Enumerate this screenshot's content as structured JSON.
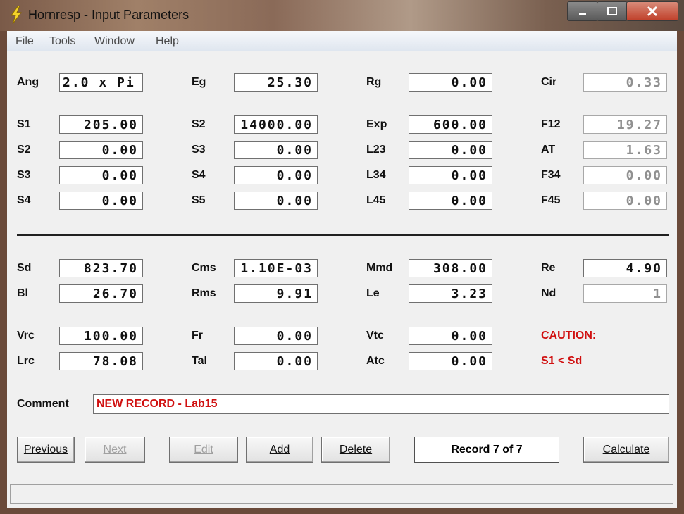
{
  "window": {
    "title": "Hornresp - Input Parameters",
    "icon": "lightning-bolt-icon"
  },
  "menu": [
    "File",
    "Tools",
    "Window",
    "Help"
  ],
  "row_ang": {
    "Ang": "2.0 x Pi",
    "Eg": "25.30",
    "Rg": "0.00",
    "Cir": "0.33"
  },
  "labels": {
    "ang": "Ang",
    "eg": "Eg",
    "rg": "Rg",
    "cir": "Cir",
    "s1": "S1",
    "s2b": "S2",
    "exp": "Exp",
    "f12": "F12",
    "s2": "S2",
    "s3b": "S3",
    "l23": "L23",
    "at": "AT",
    "s3": "S3",
    "s4b": "S4",
    "l34": "L34",
    "f34": "F34",
    "s4": "S4",
    "s5": "S5",
    "l45": "L45",
    "f45": "F45",
    "sd": "Sd",
    "cms": "Cms",
    "mmd": "Mmd",
    "re": "Re",
    "bl": "Bl",
    "rms": "Rms",
    "le": "Le",
    "nd": "Nd",
    "vrc": "Vrc",
    "fr": "Fr",
    "vtc": "Vtc",
    "lrc": "Lrc",
    "tal": "Tal",
    "atc": "Atc",
    "comment": "Comment"
  },
  "values": {
    "ang": "2.0 x Pi",
    "eg": "25.30",
    "rg": "0.00",
    "cir": "0.33",
    "s1": "205.00",
    "s2b": "14000.00",
    "exp": "600.00",
    "f12": "19.27",
    "s2": "0.00",
    "s3b": "0.00",
    "l23": "0.00",
    "at": "1.63",
    "s3": "0.00",
    "s4b": "0.00",
    "l34": "0.00",
    "f34": "0.00",
    "s4": "0.00",
    "s5": "0.00",
    "l45": "0.00",
    "f45": "0.00",
    "sd": "823.70",
    "cms": "1.10E-03",
    "mmd": "308.00",
    "re": "4.90",
    "bl": "26.70",
    "rms": "9.91",
    "le": "3.23",
    "nd": "1",
    "vrc": "100.00",
    "fr": "0.00",
    "vtc": "0.00",
    "lrc": "78.08",
    "tal": "0.00",
    "atc": "0.00"
  },
  "caution": {
    "title": "CAUTION:",
    "message": "S1 < Sd",
    "color": "#d01010"
  },
  "comment": "NEW RECORD - Lab15",
  "buttons": {
    "previous": "Previous",
    "next": "Next",
    "edit": "Edit",
    "add": "Add",
    "delete": "Delete",
    "calculate": "Calculate"
  },
  "record": "Record 7 of 7"
}
